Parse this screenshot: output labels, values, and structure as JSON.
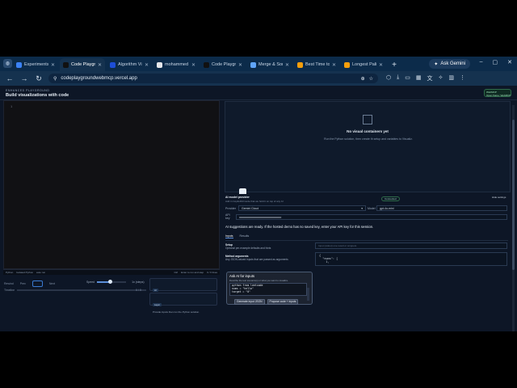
{
  "browser": {
    "profile_icon": "person-icon",
    "tabs": [
      {
        "title": "Experiments",
        "active": false,
        "color": "#3b82f6"
      },
      {
        "title": "Code Playgr",
        "active": true,
        "color": "#111111"
      },
      {
        "title": "Algorithm Vi",
        "active": false,
        "color": "#1d4ed8"
      },
      {
        "title": "mohammed",
        "active": false,
        "color": "#e5e7eb"
      },
      {
        "title": "Code Playgr",
        "active": false,
        "color": "#111111"
      },
      {
        "title": "Merge & Sort",
        "active": false,
        "color": "#60a5fa"
      },
      {
        "title": "Best Time to",
        "active": false,
        "color": "#f59e0b"
      },
      {
        "title": "Longest Pali",
        "active": false,
        "color": "#f59e0b"
      }
    ],
    "gemini_label": "Ask Gemini",
    "url": "codeplaygroundwebmcp.vercel.app"
  },
  "page": {
    "small_header": "ENHANCED PLAYGROUND",
    "title": "Build visualizations with code",
    "badge": "WebMCP\nOpen frame: WebMCP"
  },
  "editor": {
    "line_number": "1",
    "status_left": [
      "Python",
      "Isolated Python",
      "auto run"
    ],
    "status_right": [
      "Ctrl",
      "Enter to run and step",
      "0 / 0 lines"
    ]
  },
  "controls": {
    "rewind": "Rewind",
    "prev": "Prev",
    "next": "Next",
    "speed_label": "Speed",
    "speed_value": "1x (steps)",
    "speed_fraction": 0.45,
    "timeline_label": "Timeline",
    "timeline_count": "0 / 0"
  },
  "cards": [
    {
      "tag": "AI",
      "text": "Preparing a dashboard / auto program."
    },
    {
      "tag": "Layer",
      "text": "Provide inputs then run the Python solution."
    }
  ],
  "viz": {
    "title": "No visual containers yet",
    "subtitle": "Run the Python solution, then create th setup and variables to Visualiz."
  },
  "ai": {
    "title": "AI model provider",
    "subtitle": "Add in CopilotKit/mode that we hold it on top of any AI",
    "connected": "Connected",
    "hide_label": "Hide settings",
    "provider_label": "Provider",
    "provider_value": "Gemini Cloud",
    "model_label": "Model",
    "model_value": "gpt-4o-mini",
    "key_label": "API key",
    "key_value": "••••••••••••••••••••••••••••••••••••••••••••••••••••",
    "note": "AI suggestions are ready. If the hosted demo has no saved key, enter your API key for this session."
  },
  "io": {
    "tabs": [
      "Inputs",
      "Results"
    ],
    "setup_title": "Setup",
    "setup_text": "Optional per-example defaults and hints",
    "method_title": "Method arguments",
    "method_text": "Any JSON-valued inputs that are passed as arguments",
    "stdin_placeholder": "Input (stdout) one result or snippets",
    "args_text": "{\n  \"nums\": [\n    1,"
  },
  "popup": {
    "title": "Ask AI for inputs",
    "subtitle": "Describe the test scenario(s) or what you want to visualize.",
    "code": "python from leetcode\nnums = \"hello\"\ntarget = \"0\"",
    "btn_json": "Generate input JSON",
    "btn_code": "Propose code + inputs"
  }
}
